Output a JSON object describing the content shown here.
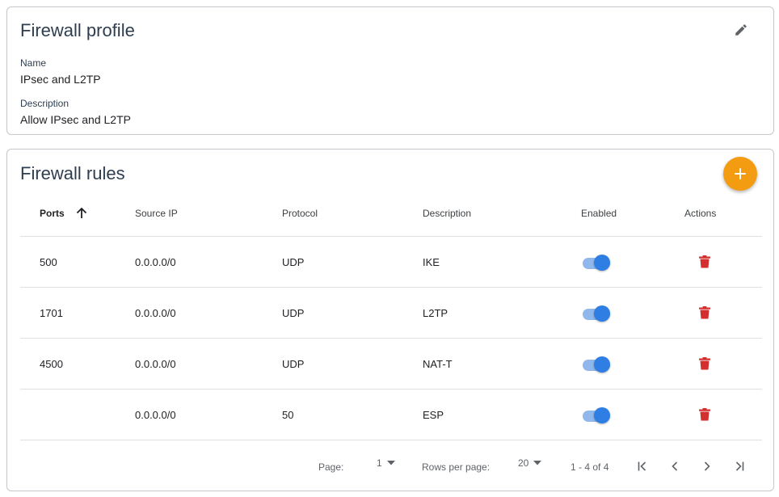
{
  "profile": {
    "title": "Firewall profile",
    "name_label": "Name",
    "name_value": "IPsec and L2TP",
    "description_label": "Description",
    "description_value": "Allow IPsec and L2TP"
  },
  "rules": {
    "title": "Firewall rules",
    "columns": {
      "ports": "Ports",
      "source_ip": "Source IP",
      "protocol": "Protocol",
      "description": "Description",
      "enabled": "Enabled",
      "actions": "Actions"
    },
    "rows": [
      {
        "ports": "500",
        "source_ip": "0.0.0.0/0",
        "protocol": "UDP",
        "description": "IKE",
        "enabled": true
      },
      {
        "ports": "1701",
        "source_ip": "0.0.0.0/0",
        "protocol": "UDP",
        "description": "L2TP",
        "enabled": true
      },
      {
        "ports": "4500",
        "source_ip": "0.0.0.0/0",
        "protocol": "UDP",
        "description": "NAT-T",
        "enabled": true
      },
      {
        "ports": "",
        "source_ip": "0.0.0.0/0",
        "protocol": "50",
        "description": "ESP",
        "enabled": true
      }
    ]
  },
  "pagination": {
    "page_label": "Page:",
    "page_value": "1",
    "rows_per_page_label": "Rows per page:",
    "rows_per_page_value": "20",
    "range": "1 - 4 of 4"
  },
  "colors": {
    "accent_orange": "#f39c12",
    "toggle_blue": "#2f7ee4",
    "delete_red": "#d32f2f",
    "title_text": "#2e3d4f"
  },
  "icons": {
    "edit": "pencil-icon",
    "add": "plus-icon",
    "sort": "arrow-up-icon",
    "delete": "trash-icon",
    "first_page": "first-page-icon",
    "prev_page": "chevron-left-icon",
    "next_page": "chevron-right-icon",
    "last_page": "last-page-icon"
  }
}
